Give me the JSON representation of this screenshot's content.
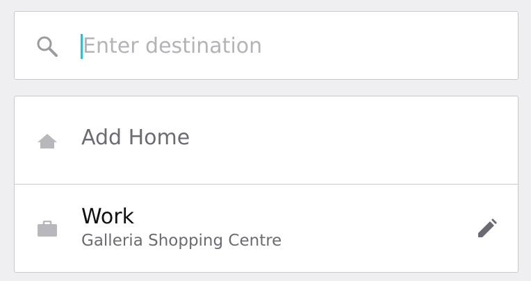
{
  "search": {
    "placeholder": "Enter destination",
    "value": ""
  },
  "places": {
    "home": {
      "label": "Add Home",
      "icon": "home-icon"
    },
    "work": {
      "title": "Work",
      "subtitle": "Galleria Shopping Centre",
      "icon": "briefcase-icon",
      "edit_icon": "pencil-icon"
    }
  },
  "colors": {
    "background": "#efeff1",
    "cursor": "#3fb7c8",
    "icon": "#b8b8bc",
    "muted_text": "#6b6b73"
  }
}
